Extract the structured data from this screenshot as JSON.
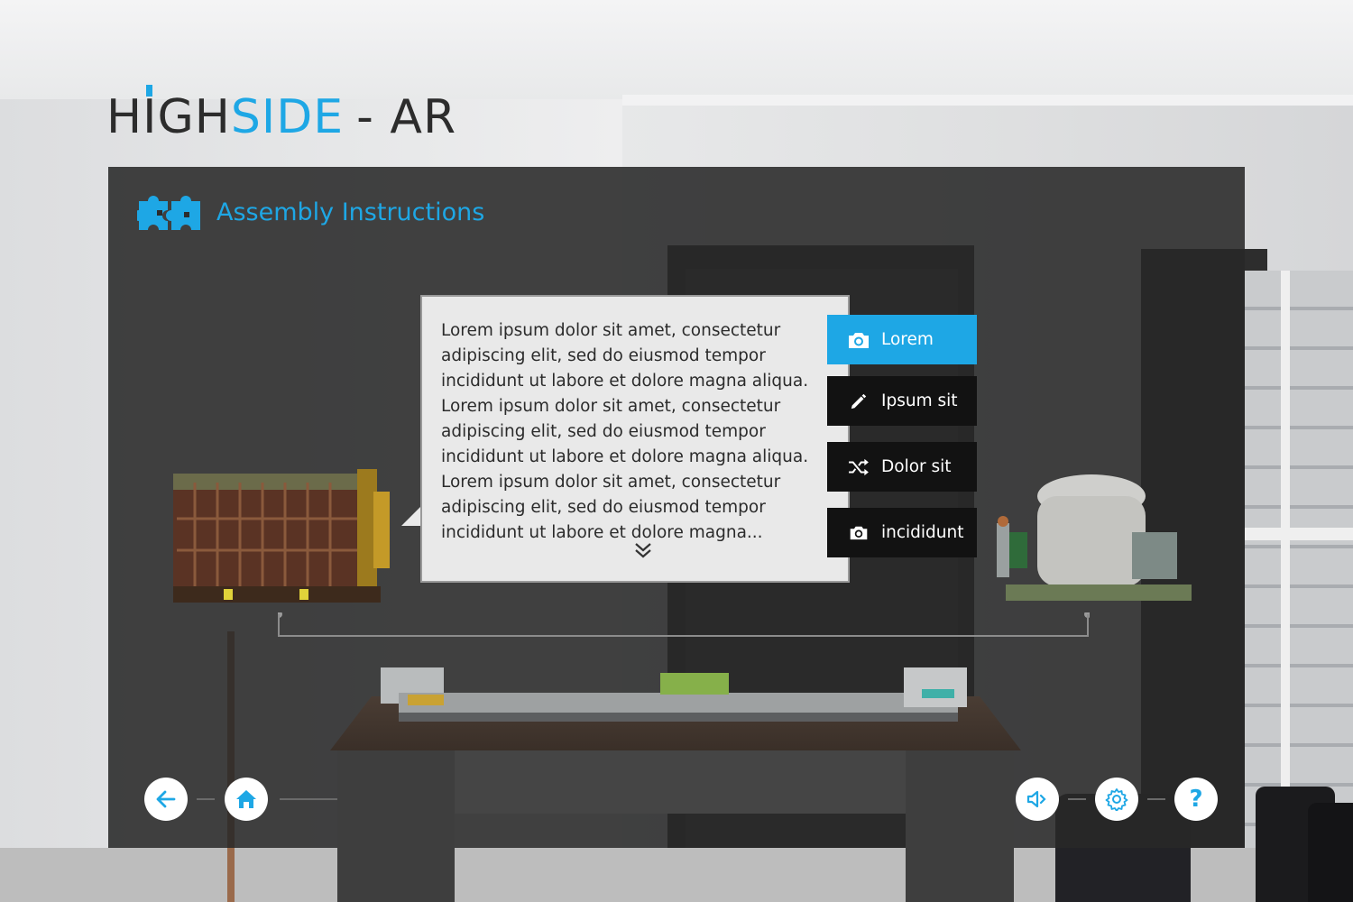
{
  "app": {
    "logo_part1": "HIGH",
    "logo_part2": "SIDE",
    "logo_part3": "- AR"
  },
  "panel": {
    "title": "Assembly Instructions",
    "title_icon": "puzzle-icon"
  },
  "popup": {
    "text": "Lorem ipsum dolor sit amet, consectetur adipiscing elit, sed do eiusmod tempor incididunt ut labore et dolore magna aliqua. Lorem ipsum dolor sit amet, consectetur adipiscing elit, sed do eiusmod tempor incididunt ut labore et dolore magna aliqua. Lorem ipsum dolor sit amet, consectetur adipiscing elit, sed do eiusmod tempor incididunt ut labore et dolore magna...",
    "expand_icon": "double-chevron-down-icon"
  },
  "menu": [
    {
      "label": "Lorem",
      "icon": "camera-icon",
      "active": true
    },
    {
      "label": "Ipsum sit",
      "icon": "pencil-icon",
      "active": false
    },
    {
      "label": "Dolor sit",
      "icon": "shuffle-icon",
      "active": false
    },
    {
      "label": "incididunt",
      "icon": "camera-icon",
      "active": false
    }
  ],
  "nav": {
    "back_icon": "arrow-left-icon",
    "home_icon": "home-icon",
    "sound_icon": "speaker-icon",
    "settings_icon": "gear-icon",
    "help_label": "?"
  },
  "colors": {
    "accent": "#1ea7e5",
    "panel_bg": "#282828",
    "menu_bg": "#121212",
    "popup_bg": "#e9e9e9"
  }
}
